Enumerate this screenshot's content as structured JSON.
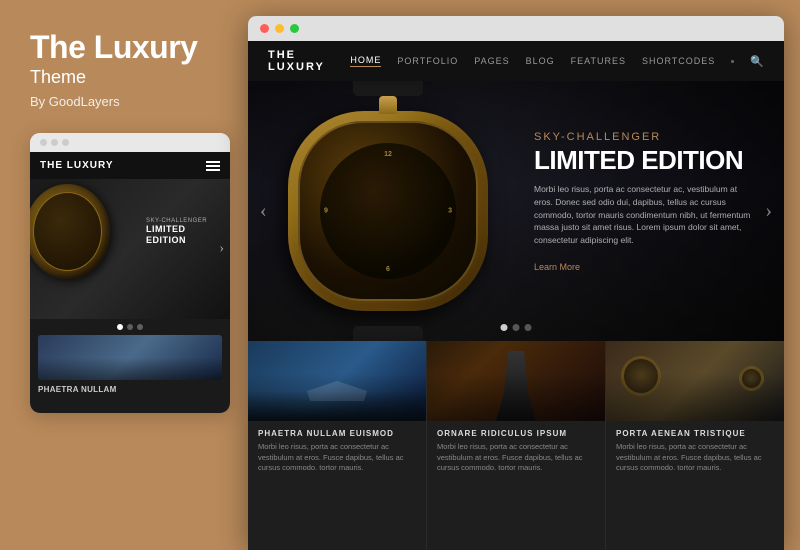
{
  "left": {
    "title": "The Luxury",
    "subtitle": "Theme",
    "by": "By GoodLayers"
  },
  "browser": {
    "dots": [
      "red",
      "yellow",
      "green"
    ]
  },
  "site": {
    "logo": "THE LUXURY",
    "nav": [
      {
        "label": "HOME",
        "active": true
      },
      {
        "label": "PORTFOLIO",
        "active": false
      },
      {
        "label": "PAGES",
        "active": false
      },
      {
        "label": "BLOG",
        "active": false
      },
      {
        "label": "FEATURES",
        "active": false
      },
      {
        "label": "SHORTCODES",
        "active": false
      }
    ]
  },
  "hero": {
    "badge": "SKY-CHALLENGER",
    "title": "LIMITED EDITION",
    "body": "Morbi leo risus, porta ac consectetur ac, vestibulum at eros. Donec sed odio dui, dapibus, tellus ac cursus commodo, tortor mauris condimentum nibh, ut fermentum massa justo sit amet risus. Lorem ipsum dolor sit amet, consectetur adipiscing elit.",
    "cta": "Learn More",
    "slider_dots": [
      true,
      false,
      false
    ]
  },
  "cards": [
    {
      "title": "PHAETRA NULLAM EUISMOD",
      "text": "Morbi leo risus, porta ac consectetur ac vestibulum at eros. Fusce dapibus, tellus ac cursus commodo. tortor mauris."
    },
    {
      "title": "ORNARE RIDICULUS IPSUM",
      "text": "Morbi leo risus, porta ac consectetur ac vestibulum at eros. Fusce dapibus, tellus ac cursus commodo. tortor mauris."
    },
    {
      "title": "PORTA AENEAN TRISTIQUE",
      "text": "Morbi leo risus, porta ac consectetur ac vestibulum at eros. Fusce dapibus, tellus ac cursus commodo. tortor mauris."
    }
  ],
  "mobile": {
    "logo": "THE LUXURY",
    "hero_badge": "SKY-CHALLENGER",
    "hero_title": "LIMITED EDITION",
    "thumb_label": "PHAETRA NULLAM",
    "slider_dots": [
      true,
      false,
      false
    ]
  }
}
